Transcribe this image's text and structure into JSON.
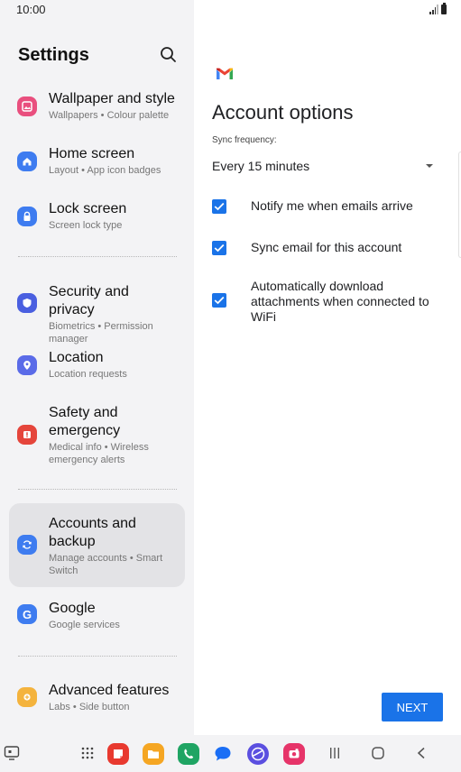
{
  "status_bar": {
    "time": "10:00"
  },
  "settings": {
    "title": "Settings",
    "items": [
      {
        "title": "Wallpaper and style",
        "subtitle": "Wallpapers • Colour palette",
        "icon": "wallpaper-icon",
        "color": "#e94f7e"
      },
      {
        "title": "Home screen",
        "subtitle": "Layout • App icon badges",
        "icon": "home-icon",
        "color": "#3e7cf0"
      },
      {
        "title": "Lock screen",
        "subtitle": "Screen lock type",
        "icon": "lock-icon",
        "color": "#3e7cf0"
      },
      {
        "title": "Security and privacy",
        "subtitle": "Biometrics • Permission manager",
        "icon": "shield-icon",
        "color": "#4a5fe0"
      },
      {
        "title": "Location",
        "subtitle": "Location requests",
        "icon": "location-icon",
        "color": "#5a6be8"
      },
      {
        "title": "Safety and emergency",
        "subtitle": "Medical info • Wireless emergency alerts",
        "icon": "emergency-icon",
        "color": "#e5453b"
      },
      {
        "title": "Accounts and backup",
        "subtitle": "Manage accounts • Smart Switch",
        "icon": "sync-icon",
        "color": "#3e7cf0"
      },
      {
        "title": "Google",
        "subtitle": "Google services",
        "icon": "google-icon",
        "color": "#3e7cf0"
      },
      {
        "title": "Advanced features",
        "subtitle": "Labs • Side button",
        "icon": "gear-plus-icon",
        "color": "#f4b33d"
      }
    ]
  },
  "account": {
    "title": "Account options",
    "sync_label": "Sync frequency:",
    "sync_value": "Every 15 minutes",
    "options": [
      {
        "label": "Notify me when emails arrive",
        "checked": true
      },
      {
        "label": "Sync email for this account",
        "checked": true
      },
      {
        "label": "Automatically download attachments when connected to WiFi",
        "checked": true
      }
    ],
    "next_label": "NEXT",
    "accent": "#1a73e8"
  },
  "navbar": {
    "apps": [
      "apps-grid-icon",
      "notes-icon",
      "files-icon",
      "phone-icon",
      "messages-icon",
      "internet-icon",
      "screen-recorder-icon"
    ]
  }
}
